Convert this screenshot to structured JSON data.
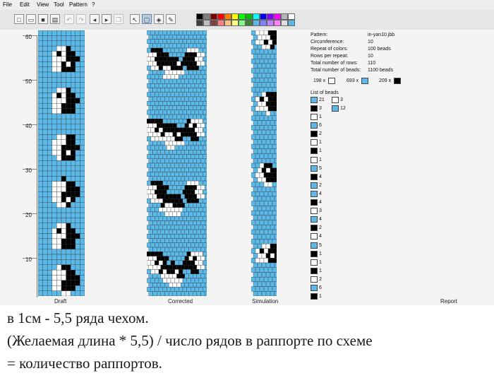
{
  "menu": [
    "File",
    "Edit",
    "View",
    "Tool",
    "Pattern",
    "?"
  ],
  "toolbar": {
    "new_icon": "new-document-icon",
    "open_icon": "open-folder-icon",
    "save_icon": "save-icon",
    "print_icon": "print-icon",
    "undo_icon": "undo-icon",
    "redo_icon": "redo-icon",
    "arrow_left_icon": "arrow-left-icon",
    "arrow_right_icon": "arrow-right-icon",
    "copy_icon": "copy-icon",
    "pointer_icon": "pointer-icon",
    "select_icon": "select-rectangle-icon",
    "fill_icon": "fill-bucket-icon",
    "pencil_icon": "pencil-icon",
    "palette_row1": [
      "#000000",
      "#808080",
      "#800000",
      "#ff0000",
      "#ff8000",
      "#ffff00",
      "#00ff00",
      "#00c000",
      "#00ffff",
      "#0000ff",
      "#8000ff",
      "#ff00ff",
      "#b5b5b5",
      "#ffffff"
    ],
    "palette_row2": [
      "#404040",
      "#c0c0c0",
      "#804040",
      "#ff8080",
      "#ffc080",
      "#ffff80",
      "#80ff80",
      "#408040",
      "#5bb9e9",
      "#8080ff",
      "#c080ff",
      "#ff80ff",
      "#e0e0e0",
      "#5bb9e9"
    ]
  },
  "ruler": {
    "ticks": [
      "60",
      "50",
      "40",
      "30",
      "20",
      "10"
    ]
  },
  "panels": {
    "draft": "Draft",
    "corrected": "Corrected",
    "simulation": "Simulation",
    "report": "Report"
  },
  "colors": {
    "blue": "#5bb9e9",
    "black": "#000000",
    "white": "#ffffff",
    "grid": "#333333"
  },
  "report": {
    "pattern_label": "Pattern:",
    "pattern_value": "in-yan10.jbb",
    "circ_label": "Circumference:",
    "circ_value": "10",
    "repeat_label": "Repeat of colors:",
    "repeat_value": "100 beads",
    "rows_label": "Rows per repeat:",
    "rows_value": "10",
    "total_rows_label": "Total number of rows:",
    "total_rows_value": "110",
    "total_beads_label": "Total number of beads:",
    "total_beads_value": "1100 beads",
    "counts": [
      {
        "text": "198 x",
        "color": "#ffffff"
      },
      {
        "text": "693 x",
        "color": "#5bb9e9"
      },
      {
        "text": "209 x",
        "color": "#000000"
      }
    ],
    "list_title": "List of beads",
    "list_first": [
      {
        "color": "#5bb9e9",
        "count": "21"
      },
      {
        "color": "#000000",
        "count": "3"
      }
    ],
    "list_second": [
      {
        "color": "#ffffff",
        "count": "3"
      },
      {
        "color": "#5bb9e9",
        "count": "12"
      }
    ],
    "list": [
      {
        "color": "#ffffff",
        "count": "1"
      },
      {
        "color": "#5bb9e9",
        "count": "6"
      },
      {
        "color": "#000000",
        "count": "2"
      },
      {
        "color": "#ffffff",
        "count": "1"
      },
      {
        "color": "#000000",
        "count": "1"
      },
      {
        "color": "#ffffff",
        "count": "1"
      },
      {
        "color": "#5bb9e9",
        "count": "5"
      },
      {
        "color": "#000000",
        "count": "4"
      },
      {
        "color": "#5bb9e9",
        "count": "2"
      },
      {
        "color": "#5bb9e9",
        "count": "4"
      },
      {
        "color": "#000000",
        "count": "4"
      },
      {
        "color": "#ffffff",
        "count": "3"
      },
      {
        "color": "#5bb9e9",
        "count": "4"
      },
      {
        "color": "#000000",
        "count": "2"
      },
      {
        "color": "#ffffff",
        "count": "4"
      },
      {
        "color": "#5bb9e9",
        "count": "5"
      },
      {
        "color": "#000000",
        "count": "1"
      },
      {
        "color": "#ffffff",
        "count": "1"
      },
      {
        "color": "#000000",
        "count": "1"
      },
      {
        "color": "#ffffff",
        "count": "2"
      },
      {
        "color": "#5bb9e9",
        "count": "6"
      },
      {
        "color": "#000000",
        "count": "1"
      }
    ]
  },
  "caption": {
    "line1": "в 1см - 5,5 ряда чехом.",
    "line2": "(Желаемая длина * 5,5) / число рядов в раппорте по схеме",
    "line3": "= количество раппортов."
  }
}
